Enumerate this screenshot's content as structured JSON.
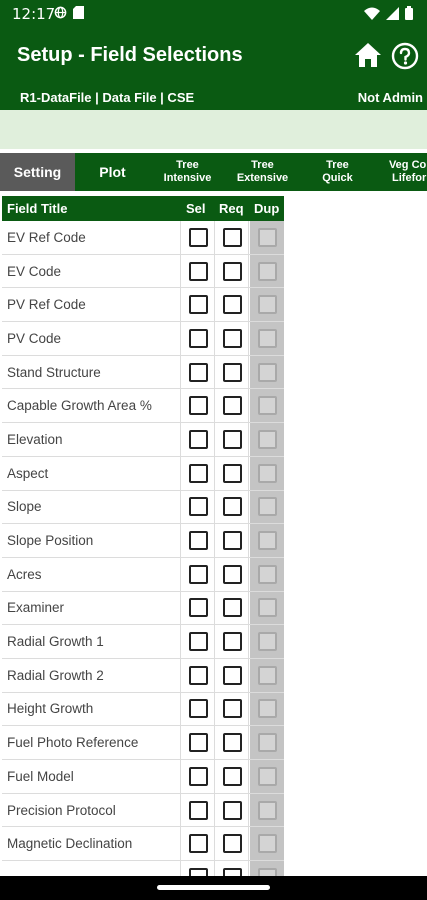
{
  "status_bar": {
    "time": "12:17",
    "left_icons": [
      "vpn-globe-icon",
      "sd-card-icon"
    ],
    "right_icons": [
      "wifi-icon",
      "signal-icon",
      "battery-icon"
    ]
  },
  "app_bar": {
    "title": "Setup - Field Selections",
    "subtitle_left": "R1-DataFile | Data File | CSE",
    "subtitle_right": "Not Admin",
    "actions": [
      "home-icon",
      "help-icon"
    ]
  },
  "tabs": [
    {
      "label": "Setting",
      "active": true
    },
    {
      "label": "Plot"
    },
    {
      "label": "Tree\nIntensive"
    },
    {
      "label": "Tree\nExtensive"
    },
    {
      "label": "Tree\nQuick"
    },
    {
      "label": "Veg Com\nLifeforn"
    }
  ],
  "grid": {
    "headers": {
      "title": "Field Title",
      "sel": "Sel",
      "req": "Req",
      "dup": "Dup"
    },
    "rows": [
      {
        "title": "EV Ref Code",
        "sel": false,
        "req": false,
        "dup": false
      },
      {
        "title": "EV Code",
        "sel": false,
        "req": false,
        "dup": false
      },
      {
        "title": "PV Ref Code",
        "sel": false,
        "req": false,
        "dup": false
      },
      {
        "title": "PV Code",
        "sel": false,
        "req": false,
        "dup": false
      },
      {
        "title": "Stand Structure",
        "sel": false,
        "req": false,
        "dup": false
      },
      {
        "title": "Capable Growth Area %",
        "sel": false,
        "req": false,
        "dup": false
      },
      {
        "title": "Elevation",
        "sel": false,
        "req": false,
        "dup": false
      },
      {
        "title": "Aspect",
        "sel": false,
        "req": false,
        "dup": false
      },
      {
        "title": "Slope",
        "sel": false,
        "req": false,
        "dup": false
      },
      {
        "title": "Slope Position",
        "sel": false,
        "req": false,
        "dup": false
      },
      {
        "title": "Acres",
        "sel": false,
        "req": false,
        "dup": false
      },
      {
        "title": "Examiner",
        "sel": false,
        "req": false,
        "dup": false
      },
      {
        "title": "Radial Growth 1",
        "sel": false,
        "req": false,
        "dup": false
      },
      {
        "title": "Radial Growth 2",
        "sel": false,
        "req": false,
        "dup": false
      },
      {
        "title": "Height Growth",
        "sel": false,
        "req": false,
        "dup": false
      },
      {
        "title": "Fuel Photo Reference",
        "sel": false,
        "req": false,
        "dup": false
      },
      {
        "title": "Fuel Model",
        "sel": false,
        "req": false,
        "dup": false
      },
      {
        "title": "Precision Protocol",
        "sel": false,
        "req": false,
        "dup": false
      },
      {
        "title": "Magnetic Declination",
        "sel": false,
        "req": false,
        "dup": false
      },
      {
        "title": "",
        "sel": false,
        "req": false,
        "dup": false
      }
    ]
  },
  "colors": {
    "primary_green": "#0a5a12",
    "light_green_band": "#e0efdc",
    "active_tab_gray": "#5a5a5a",
    "dup_column_gray": "#c4c4c4"
  }
}
